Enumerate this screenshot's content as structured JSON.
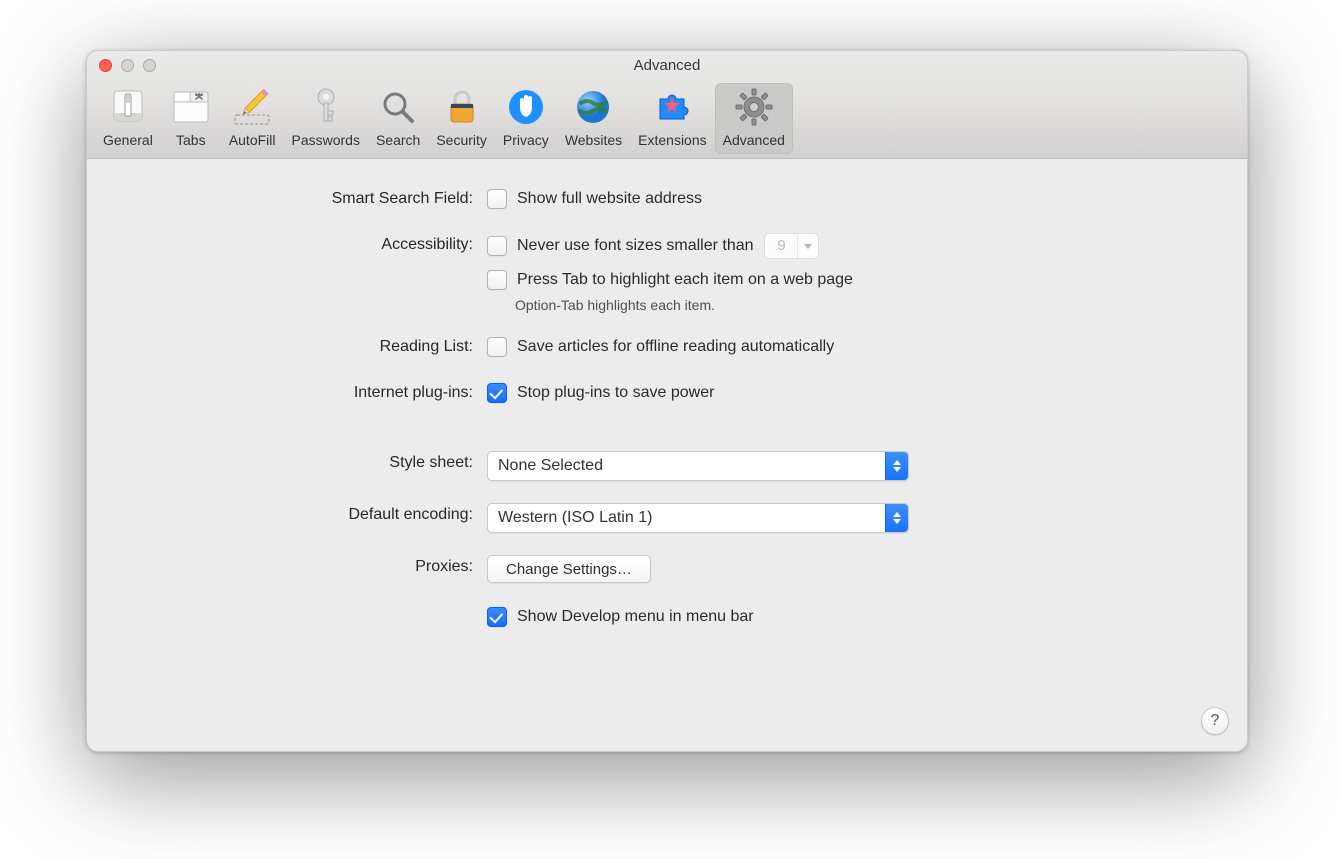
{
  "window": {
    "title": "Advanced"
  },
  "toolbar": {
    "items": [
      {
        "key": "general",
        "label": "General"
      },
      {
        "key": "tabs",
        "label": "Tabs"
      },
      {
        "key": "autofill",
        "label": "AutoFill"
      },
      {
        "key": "passwords",
        "label": "Passwords"
      },
      {
        "key": "search",
        "label": "Search"
      },
      {
        "key": "security",
        "label": "Security"
      },
      {
        "key": "privacy",
        "label": "Privacy"
      },
      {
        "key": "websites",
        "label": "Websites"
      },
      {
        "key": "extensions",
        "label": "Extensions"
      },
      {
        "key": "advanced",
        "label": "Advanced"
      }
    ],
    "active": "advanced"
  },
  "form": {
    "smartSearch": {
      "label": "Smart Search Field:",
      "showFullAddress": {
        "label": "Show full website address",
        "checked": false
      }
    },
    "accessibility": {
      "label": "Accessibility:",
      "minFontSize": {
        "label": "Never use font sizes smaller than",
        "checked": false,
        "value": "9"
      },
      "tabHighlight": {
        "label": "Press Tab to highlight each item on a web page",
        "checked": false
      },
      "hint": "Option-Tab highlights each item."
    },
    "readingList": {
      "label": "Reading List:",
      "saveOffline": {
        "label": "Save articles for offline reading automatically",
        "checked": false
      }
    },
    "plugins": {
      "label": "Internet plug-ins:",
      "stopToSavePower": {
        "label": "Stop plug-ins to save power",
        "checked": true
      }
    },
    "styleSheet": {
      "label": "Style sheet:",
      "value": "None Selected"
    },
    "defaultEncoding": {
      "label": "Default encoding:",
      "value": "Western (ISO Latin 1)"
    },
    "proxies": {
      "label": "Proxies:",
      "button": "Change Settings…"
    },
    "developMenu": {
      "label": "Show Develop menu in menu bar",
      "checked": true
    }
  },
  "help": "?"
}
